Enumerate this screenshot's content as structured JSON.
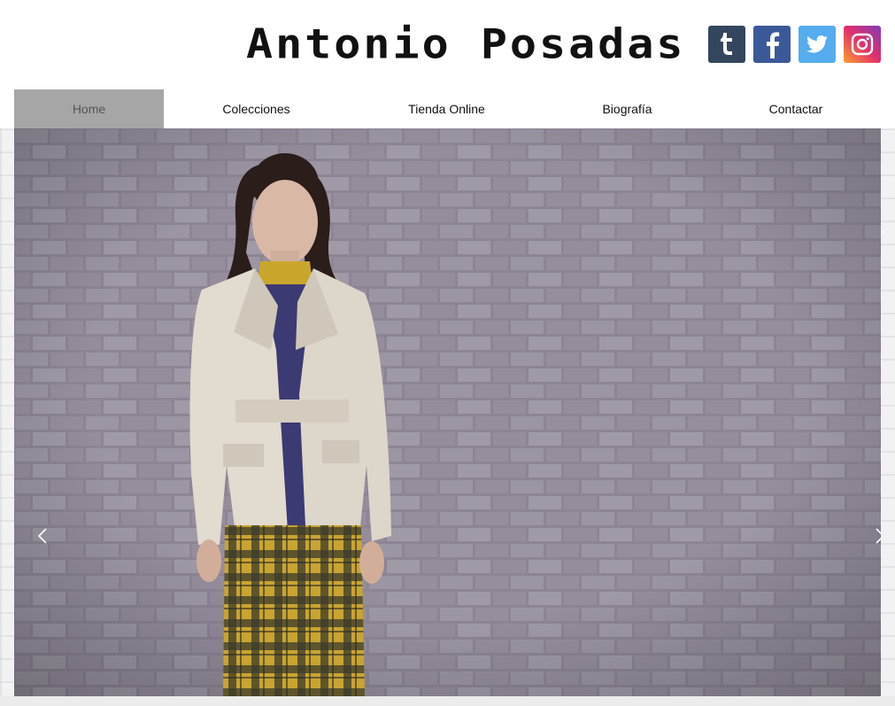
{
  "header": {
    "site_title": "Antonio Posadas"
  },
  "social": [
    {
      "name": "tumblr",
      "icon": "tumblr-icon",
      "color": "#34465d"
    },
    {
      "name": "facebook",
      "icon": "facebook-icon",
      "color": "#3b5998"
    },
    {
      "name": "twitter",
      "icon": "twitter-icon",
      "color": "#55acee"
    },
    {
      "name": "instagram",
      "icon": "instagram-icon",
      "color": "#c13584"
    }
  ],
  "nav": {
    "items": [
      {
        "label": "Home",
        "active": true
      },
      {
        "label": "Colecciones",
        "active": false
      },
      {
        "label": "Tienda Online",
        "active": false
      },
      {
        "label": "Biografía",
        "active": false
      },
      {
        "label": "Contactar",
        "active": false
      }
    ]
  },
  "slideshow": {
    "prev_icon": "chevron-left-icon",
    "next_icon": "chevron-right-icon",
    "slide_image": "fashion-model-photo"
  },
  "colors": {
    "nav_active_bg": "#a6a6a6",
    "brick_wall": "#8b8391"
  }
}
